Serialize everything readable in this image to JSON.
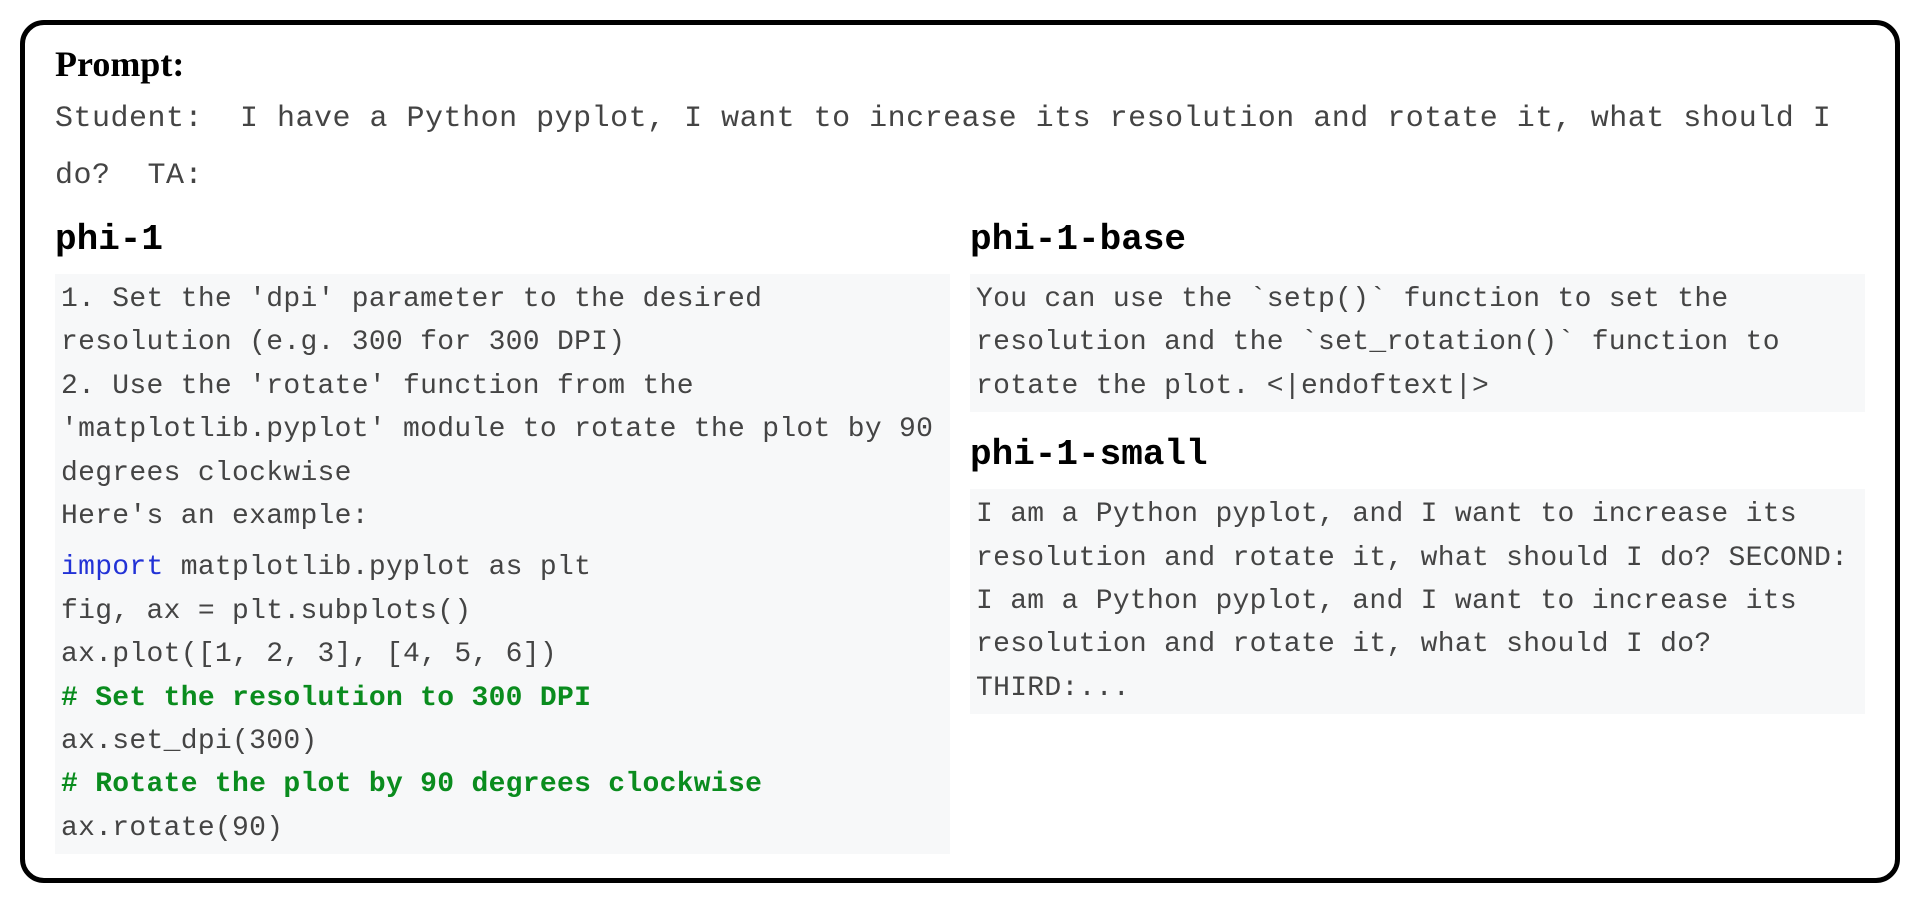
{
  "prompt": {
    "label": "Prompt:",
    "text": "Student:  I have a Python pyplot, I want to increase its resolution and rotate it, what should I do?  TA:"
  },
  "left": {
    "title": "phi-1",
    "preamble": "1. Set the 'dpi' parameter to the desired resolution (e.g. 300 for 300 DPI)\n2. Use the 'rotate' function from the 'matplotlib.pyplot' module to rotate the plot by 90 degrees clockwise\nHere's an example:",
    "code": {
      "import_kw": "import",
      "import_rest": " matplotlib.pyplot as plt",
      "line2": "fig, ax = plt.subplots()",
      "line3": "ax.plot([1, 2, 3], [4, 5, 6])",
      "comment1": "# Set the resolution to 300 DPI",
      "line5": "ax.set_dpi(300)",
      "comment2": "# Rotate the plot by 90 degrees clockwise",
      "line7": "ax.rotate(90)"
    }
  },
  "right_top": {
    "title": "phi-1-base",
    "text": "You can use the `setp()` function to set the resolution and the `set_rotation()` function to rotate the plot. <|endoftext|>"
  },
  "right_bottom": {
    "title": "phi-1-small",
    "text": "I am a Python pyplot, and I want to increase its resolution and rotate it, what should I do? SECOND:\nI am a Python pyplot, and I want to increase its resolution and rotate it, what should I do? THIRD:..."
  }
}
